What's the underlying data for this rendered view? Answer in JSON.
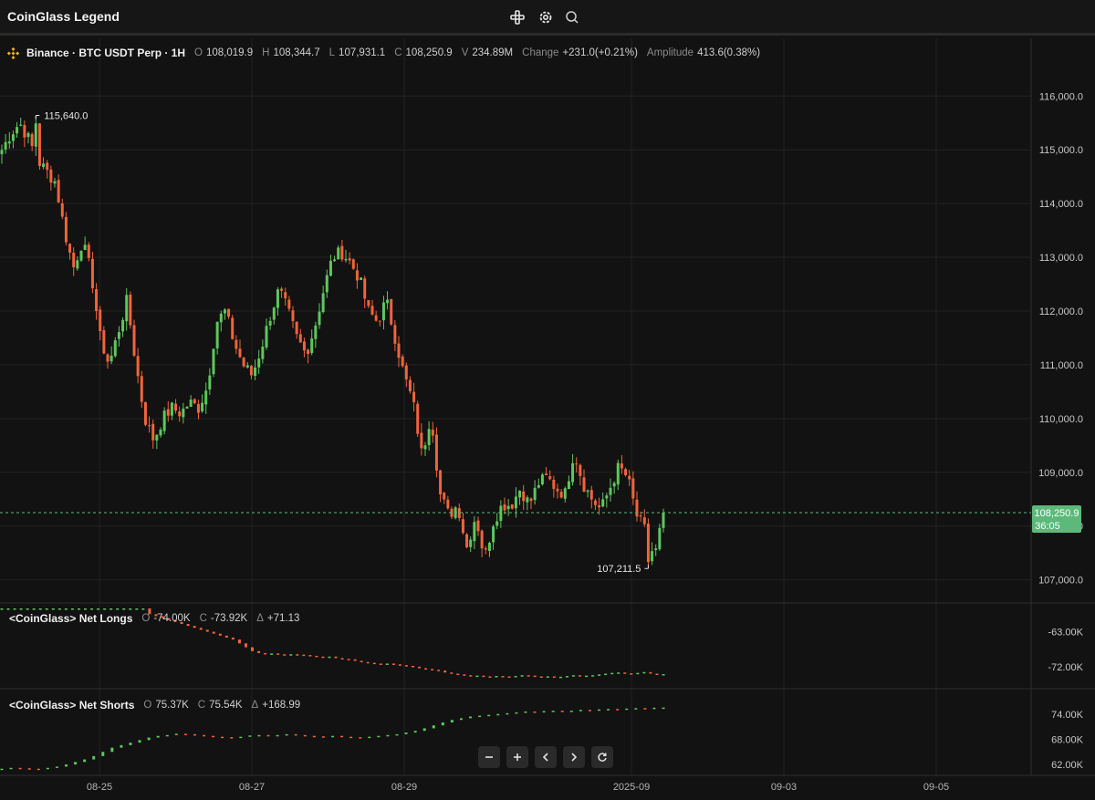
{
  "header": {
    "title": "CoinGlass Legend",
    "icons": [
      "crosshair-icon",
      "settings-icon",
      "search-icon"
    ]
  },
  "colors": {
    "up": "#5cc85c",
    "down": "#f0643c",
    "grid": "#232323",
    "bg": "#121212",
    "price_tag": "#5cb97a"
  },
  "legend": {
    "symbol": "Binance · BTC USDT Perp · 1H",
    "o_label": "O",
    "o": "108,019.9",
    "h_label": "H",
    "h": "108,344.7",
    "l_label": "L",
    "l": "107,931.1",
    "c_label": "C",
    "c": "108,250.9",
    "v_label": "V",
    "v": "234.89M",
    "change_label": "Change",
    "change": "+231.0(+0.21%)",
    "amp_label": "Amplitude",
    "amp": "413.6(0.38%)"
  },
  "price_tag": {
    "price": "108,250.9",
    "countdown": "36:05"
  },
  "net_longs": {
    "title": "<CoinGlass> Net Longs",
    "o_label": "O",
    "o": "-74.00K",
    "c_label": "C",
    "c": "-73.92K",
    "d_label": "Δ",
    "d": "+71.13"
  },
  "net_shorts": {
    "title": "<CoinGlass> Net Shorts",
    "o_label": "O",
    "o": "75.37K",
    "c_label": "C",
    "c": "75.54K",
    "d_label": "Δ",
    "d": "+168.99"
  },
  "nav_buttons": [
    "zoom-out",
    "zoom-in",
    "scroll-left",
    "scroll-right",
    "reset"
  ],
  "chart_data": [
    {
      "type": "candlestick",
      "title": "Binance · BTC USDT Perp · 1H",
      "x_tick_labels": [
        "08-25",
        "08-27",
        "08-29",
        "2025-09",
        "09-03",
        "09-05"
      ],
      "y_ticks": [
        107000,
        108000,
        109000,
        110000,
        111000,
        112000,
        113000,
        114000,
        115000,
        116000
      ],
      "y_tick_labels": [
        "107,000.0",
        "108,000.0",
        "109,000.0",
        "110,000.0",
        "111,000.0",
        "112,000.0",
        "113,000.0",
        "114,000.0",
        "115,000.0",
        "116,000.0"
      ],
      "ylim": [
        106570,
        116700
      ],
      "annotations": {
        "high": 115640.0,
        "high_label": "115,640.0",
        "low": 107211.5,
        "low_label": "107,211.5"
      },
      "last_price": 108250.9,
      "close_path": [
        115000,
        115300,
        115500,
        115200,
        114800,
        114600,
        114400,
        113500,
        112800,
        113300,
        112700,
        111500,
        111000,
        111600,
        112200,
        111000,
        110000,
        109600,
        110000,
        110200,
        110100,
        110300,
        110200,
        110600,
        111800,
        112000,
        111400,
        111000,
        110800,
        111300,
        111900,
        112400,
        112000,
        111500,
        111200,
        111700,
        112400,
        113000,
        113100,
        112900,
        112600,
        112000,
        111800,
        112200,
        111500,
        110800,
        110300,
        109300,
        110100,
        108600,
        108200,
        108400,
        107600,
        108200,
        107400,
        108100,
        108400,
        108400,
        108700,
        108400,
        108800,
        108900,
        108700,
        108600,
        109400,
        108800,
        108500,
        108300,
        108700,
        109100,
        108900,
        108200,
        107900,
        107400,
        108250
      ],
      "high_point": [
        9,
        115640
      ],
      "low_point": [
        171,
        107211.5
      ],
      "n_candles": 176
    },
    {
      "type": "bar",
      "title": "<CoinGlass> Net Longs",
      "y_tick_labels": [
        "-63.00K",
        "-72.00K"
      ],
      "y_ticks": [
        -63,
        -72
      ],
      "ylim": [
        -76.5,
        -57
      ],
      "unit": "K",
      "path": [
        -57,
        -57,
        -57,
        -57,
        -57,
        -57,
        -57,
        -57,
        -57,
        -57,
        -57,
        -57,
        -57,
        -57,
        -57,
        -57,
        -57,
        -57,
        -57,
        -57,
        -57,
        -57,
        -57,
        -58.5,
        -59,
        -59.5,
        -60,
        -60.5,
        -61,
        -61.5,
        -62,
        -62.5,
        -63,
        -63.5,
        -64,
        -64.5,
        -65,
        -66,
        -67,
        -68,
        -68.5,
        -68.7,
        -68.6,
        -68.8,
        -69,
        -68.8,
        -68.9,
        -69,
        -69.2,
        -69.4,
        -69.6,
        -69.4,
        -69.8,
        -70,
        -70.1,
        -70.5,
        -70.8,
        -71,
        -71.2,
        -71.5,
        -71.2,
        -71.4,
        -71.6,
        -71.8,
        -72,
        -72.4,
        -72.6,
        -72.8,
        -73,
        -73.5,
        -73.8,
        -74,
        -74.2,
        -74.4,
        -74.3,
        -74.5,
        -74.6,
        -74.4,
        -74.5,
        -74.6,
        -74.4,
        -74.2,
        -74.3,
        -74.5,
        -74.6,
        -74.5,
        -74.7,
        -74.6,
        -74.4,
        -74.2,
        -74.4,
        -74.3,
        -74.2,
        -74,
        -73.8,
        -73.6,
        -73.5,
        -73.7,
        -73.8,
        -73.6,
        -73.4,
        -73.8,
        -74.0,
        -73.92
      ],
      "last": -73.92
    },
    {
      "type": "bar",
      "title": "<CoinGlass> Net Shorts",
      "y_tick_labels": [
        "74.00K",
        "68.00K",
        "62.00K"
      ],
      "y_ticks": [
        74,
        68,
        62
      ],
      "ylim": [
        60.5,
        78.5
      ],
      "unit": "K",
      "path": [
        61,
        61.2,
        61.1,
        61,
        60.9,
        61.2,
        61.5,
        62,
        62.6,
        63.2,
        64,
        65,
        66,
        66.6,
        67.2,
        67.8,
        68.4,
        68.8,
        69,
        69.3,
        69.2,
        69,
        68.8,
        68.6,
        68.5,
        68.4,
        68.6,
        68.9,
        69,
        68.8,
        69,
        69.2,
        69,
        68.8,
        68.7,
        68.6,
        68.8,
        68.6,
        68.5,
        68.4,
        68.6,
        68.8,
        69,
        69.2,
        69.6,
        70,
        70.6,
        71.3,
        72,
        72.6,
        73,
        73.4,
        73.6,
        73.8,
        74,
        74.2,
        74.4,
        74.6,
        74.5,
        74.7,
        74.8,
        74.6,
        74.8,
        75,
        74.9,
        75.1,
        75.2,
        75.1,
        75.3,
        75.4,
        75.37,
        75.5,
        75.54
      ],
      "last": 75.54
    }
  ]
}
